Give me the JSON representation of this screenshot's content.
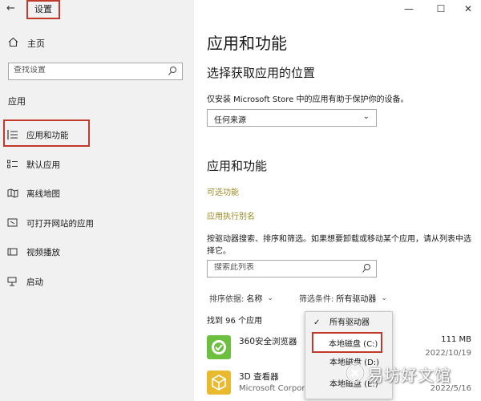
{
  "window": {
    "title": "设置",
    "controls": {
      "minimize": "—",
      "maximize": "☐",
      "close": "✕"
    }
  },
  "sidebar": {
    "home_label": "主页",
    "search_placeholder": "查找设置",
    "section_label": "应用",
    "items": [
      {
        "label": "应用和功能",
        "icon": "apps-features-icon",
        "selected": true
      },
      {
        "label": "默认应用",
        "icon": "default-apps-icon"
      },
      {
        "label": "离线地图",
        "icon": "offline-maps-icon"
      },
      {
        "label": "可打开网站的应用",
        "icon": "apps-for-websites-icon"
      },
      {
        "label": "视频播放",
        "icon": "video-playback-icon"
      },
      {
        "label": "启动",
        "icon": "startup-icon"
      }
    ]
  },
  "main": {
    "title": "应用和功能",
    "choose_location": {
      "heading": "选择获取应用的位置",
      "description": "仅安装 Microsoft Store 中的应用有助于保护你的设备。",
      "selected": "任何来源"
    },
    "apps_features": {
      "heading": "应用和功能",
      "links": [
        "可选功能",
        "应用执行别名"
      ],
      "description": "按驱动器搜索、排序和筛选。如果想要卸载或移动某个应用，请从列表中选择它。",
      "search_placeholder": "搜索此列表",
      "sort_label": "排序依据:",
      "sort_value": "名称",
      "filter_label": "筛选条件:",
      "filter_value": "所有驱动器",
      "found_text": "找到 96 个应用"
    },
    "apps": [
      {
        "name": "360安全浏览器",
        "publisher": "",
        "size": "111 MB",
        "date": "2022/10/19",
        "icon": "360-browser-icon"
      },
      {
        "name": "3D 查看器",
        "publisher": "Microsoft Corpora",
        "size": "",
        "date": "2022/5/16",
        "icon": "3d-viewer-icon"
      }
    ]
  },
  "filter_dropdown": {
    "items": [
      {
        "label": "所有驱动器",
        "checked": true
      },
      {
        "label": "本地磁盘 (C:)",
        "highlighted": true
      },
      {
        "label": "本地磁盘 (D:)"
      },
      {
        "label": "本地磁盘 (E:)"
      }
    ]
  },
  "watermark": {
    "text": "易坊好文馆"
  },
  "colors": {
    "accent_link": "#9b8a24",
    "highlight_box": "#c0392b",
    "sidebar_bg": "#f1f1f1"
  }
}
